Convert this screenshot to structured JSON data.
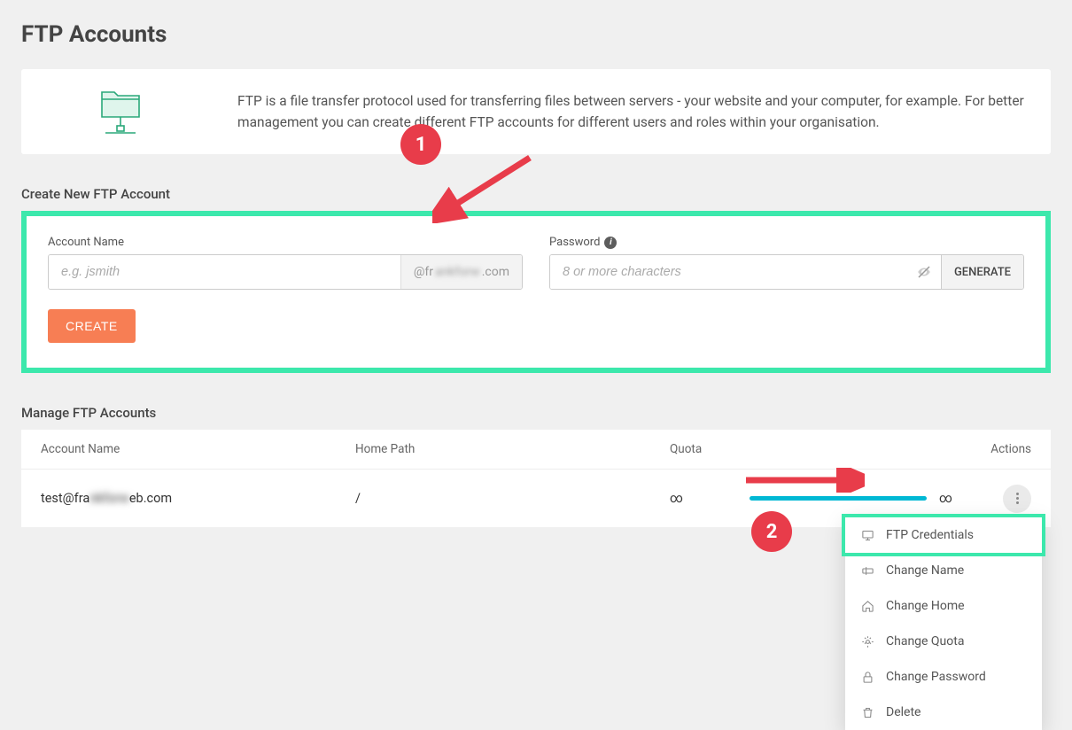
{
  "page_title": "FTP Accounts",
  "info": {
    "description": "FTP is a file transfer protocol used for transferring files between servers - your website and your computer, for example. For better management you can create different FTP accounts for different users and roles within your organisation."
  },
  "create_section": {
    "title": "Create New FTP Account",
    "account_name_label": "Account Name",
    "account_name_placeholder": "e.g. jsmith",
    "account_name_suffix_prefix": "@fr",
    "account_name_suffix_blur": "ankforw",
    "account_name_suffix_tld": ".com",
    "password_label": "Password",
    "password_placeholder": "8 or more characters",
    "generate_label": "GENERATE",
    "create_label": "CREATE"
  },
  "manage_section": {
    "title": "Manage FTP Accounts",
    "headers": {
      "account": "Account Name",
      "home": "Home Path",
      "quota": "Quota",
      "actions": "Actions"
    },
    "rows": [
      {
        "account_prefix": "test@fra",
        "account_blur": "nkforw",
        "account_suffix": "eb.com",
        "home": "/",
        "quota": "∞",
        "usage_cap": "∞"
      }
    ]
  },
  "dropdown": {
    "items": [
      {
        "label": "FTP Credentials",
        "highlight": true
      },
      {
        "label": "Change Name"
      },
      {
        "label": "Change Home"
      },
      {
        "label": "Change Quota"
      },
      {
        "label": "Change Password"
      },
      {
        "label": "Delete"
      }
    ]
  },
  "annotations": {
    "badge1": "1",
    "badge2": "2"
  }
}
